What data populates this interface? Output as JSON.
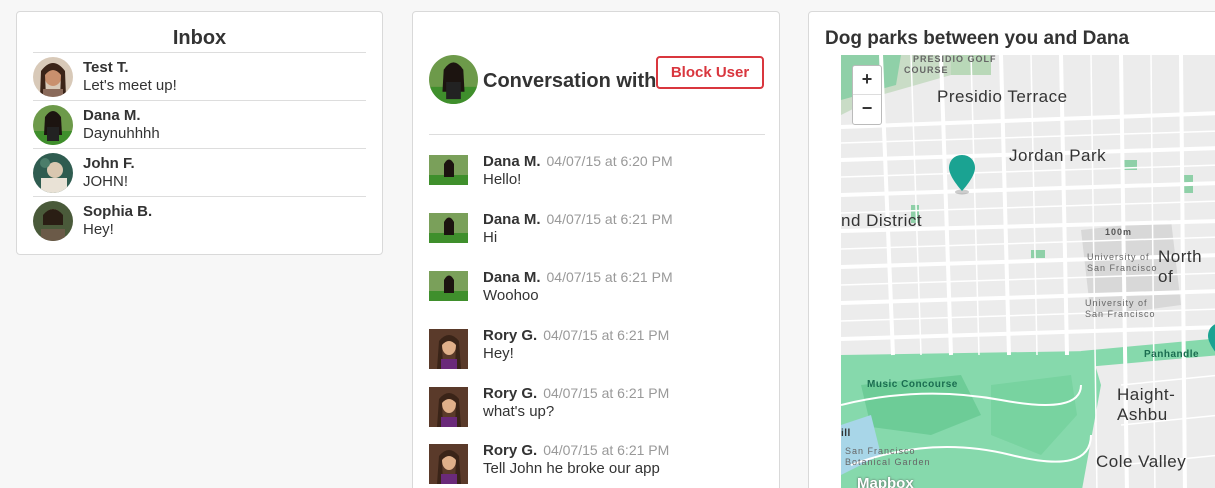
{
  "inbox": {
    "title": "Inbox",
    "items": [
      {
        "name": "Test T.",
        "preview": "Let's meet up!"
      },
      {
        "name": "Dana M.",
        "preview": "Daynuhhhh"
      },
      {
        "name": "John F.",
        "preview": "JOHN!"
      },
      {
        "name": "Sophia B.",
        "preview": "Hey!"
      }
    ]
  },
  "conversation": {
    "title": "Conversation with Dana M.",
    "block_label": "Block User",
    "messages": [
      {
        "sender": "Dana M.",
        "time": "04/07/15 at 6:20 PM",
        "text": "Hello!"
      },
      {
        "sender": "Dana M.",
        "time": "04/07/15 at 6:21 PM",
        "text": "Hi"
      },
      {
        "sender": "Dana M.",
        "time": "04/07/15 at 6:21 PM",
        "text": "Woohoo"
      },
      {
        "sender": "Rory G.",
        "time": "04/07/15 at 6:21 PM",
        "text": "Hey!"
      },
      {
        "sender": "Rory G.",
        "time": "04/07/15 at 6:21 PM",
        "text": "what's up?"
      },
      {
        "sender": "Rory G.",
        "time": "04/07/15 at 6:21 PM",
        "text": "Tell John he broke our app"
      }
    ]
  },
  "map": {
    "title": "Dog parks between you and Dana",
    "zoom_in": "+",
    "zoom_out": "−",
    "labels": {
      "presidio_golf": "PRESIDIO GOLF",
      "course": "COURSE",
      "presidio_terrace": "Presidio Terrace",
      "jordan_park": "Jordan Park",
      "district": "nd District",
      "north_of": "North of",
      "usf1": "University of",
      "usf1b": "San Francisco",
      "usf2": "University of",
      "usf2b": "San Francisco",
      "elevation": "100m",
      "panhandle": "Panhandle",
      "music_concourse": "Music Concourse",
      "haight": "Haight-Ashbu",
      "botanical": "San Francisco",
      "botanical2": "Botanical Garden",
      "cole_valley": "Cole Valley",
      "ill": "ill",
      "logo": "Mapbox"
    },
    "colors": {
      "park": "#7fd6a8",
      "marker": "#1aa392"
    }
  }
}
